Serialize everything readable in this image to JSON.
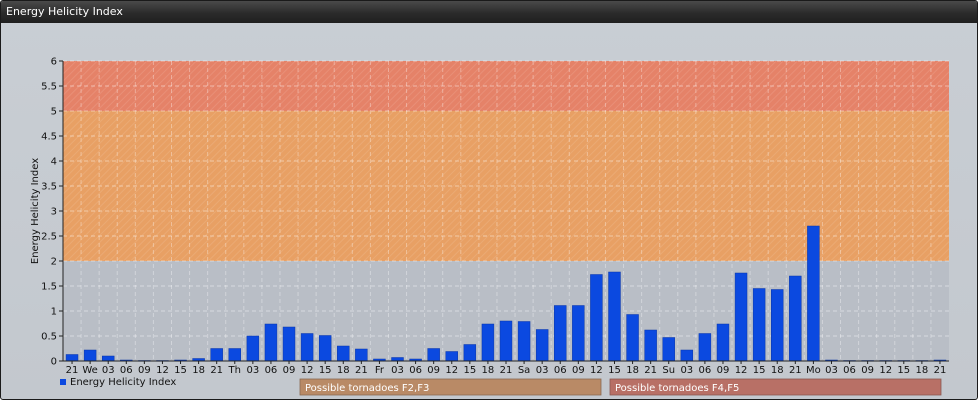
{
  "window": {
    "title": "Energy Helicity Index"
  },
  "chart_data": {
    "type": "bar",
    "title": "",
    "ylabel": "Energy Helicity Index",
    "xlabel": "",
    "ylim": [
      0,
      6
    ],
    "yticks": [
      "0",
      "0.5",
      "1",
      "1.5",
      "2",
      "2.5",
      "3",
      "3.5",
      "4",
      "4.5",
      "5",
      "5.5",
      "6"
    ],
    "grid": true,
    "legend": "bottom-left",
    "series_color": "#0b49e0",
    "categories": [
      "21",
      "We",
      "03",
      "06",
      "09",
      "12",
      "15",
      "18",
      "21",
      "Th",
      "03",
      "06",
      "09",
      "12",
      "15",
      "18",
      "21",
      "Fr",
      "03",
      "06",
      "09",
      "12",
      "15",
      "18",
      "21",
      "Sa",
      "03",
      "06",
      "09",
      "12",
      "15",
      "18",
      "21",
      "Su",
      "03",
      "06",
      "09",
      "12",
      "15",
      "18",
      "21",
      "Mo",
      "03",
      "06",
      "09",
      "12",
      "15",
      "18",
      "21"
    ],
    "series": [
      {
        "name": "Energy Helicity Index",
        "values": [
          0.13,
          0.22,
          0.1,
          0.02,
          0.01,
          0.01,
          0.02,
          0.05,
          0.25,
          0.25,
          0.5,
          0.74,
          0.68,
          0.55,
          0.51,
          0.3,
          0.24,
          0.04,
          0.07,
          0.04,
          0.25,
          0.19,
          0.33,
          0.74,
          0.8,
          0.79,
          0.63,
          1.11,
          1.11,
          1.73,
          1.78,
          0.93,
          0.62,
          0.47,
          0.22,
          0.55,
          0.74,
          1.76,
          1.45,
          1.43,
          1.7,
          2.7,
          0.02,
          0.01,
          0.01,
          0.01,
          0.01,
          0.01,
          0.02
        ]
      }
    ],
    "bands": [
      {
        "from": 2,
        "to": 5,
        "label": "Possible tornadoes F2,F3",
        "color": "#e8a064"
      },
      {
        "from": 5,
        "to": 6,
        "label": "Possible tornadoes F4,F5",
        "color": "#e58268"
      }
    ]
  }
}
